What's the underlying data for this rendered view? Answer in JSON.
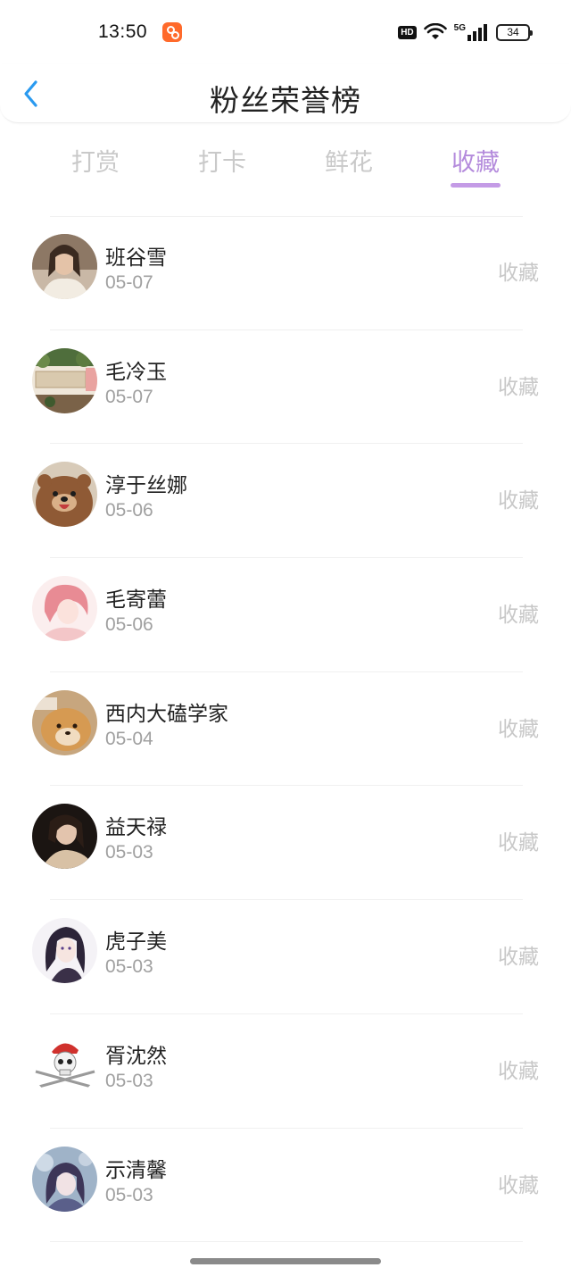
{
  "status_bar": {
    "time": "13:50",
    "app_badge_icon": "app-notification-icon",
    "hd": "HD",
    "network": "5G",
    "battery": "34",
    "icons": [
      "wifi-icon",
      "signal-icon",
      "battery-icon"
    ]
  },
  "header": {
    "back_icon": "chevron-left-icon",
    "title": "粉丝荣誉榜"
  },
  "tabs": [
    {
      "label": "打赏",
      "active": false
    },
    {
      "label": "打卡",
      "active": false
    },
    {
      "label": "鲜花",
      "active": false
    },
    {
      "label": "收藏",
      "active": true
    }
  ],
  "accent_color": "#b48bdc",
  "fans": [
    {
      "name": "班谷雪",
      "date": "05-07",
      "tag": "收藏"
    },
    {
      "name": "毛冷玉",
      "date": "05-07",
      "tag": "收藏"
    },
    {
      "name": "淳于丝娜",
      "date": "05-06",
      "tag": "收藏"
    },
    {
      "name": "毛寄蕾",
      "date": "05-06",
      "tag": "收藏"
    },
    {
      "name": "西内大磕学家",
      "date": "05-04",
      "tag": "收藏"
    },
    {
      "name": "益天禄",
      "date": "05-03",
      "tag": "收藏"
    },
    {
      "name": "虎子美",
      "date": "05-03",
      "tag": "收藏"
    },
    {
      "name": "胥沈然",
      "date": "05-03",
      "tag": "收藏"
    },
    {
      "name": "示清馨",
      "date": "05-03",
      "tag": "收藏"
    }
  ]
}
